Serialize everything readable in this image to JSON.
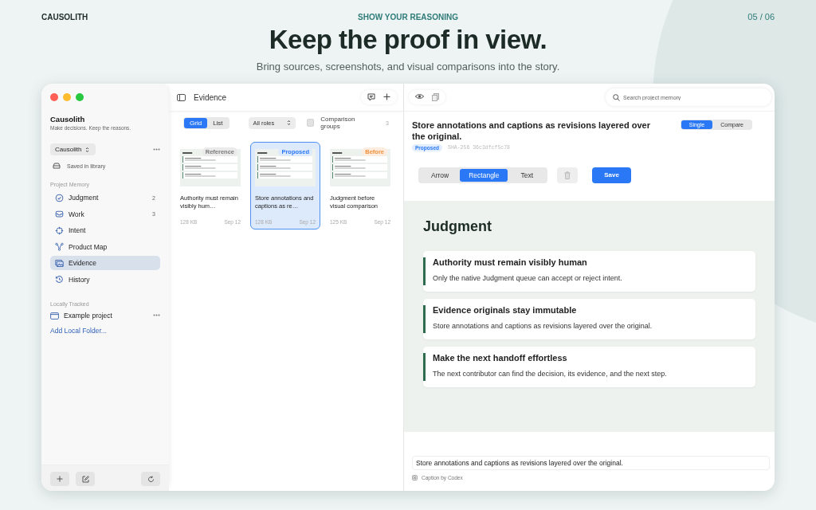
{
  "header": {
    "brand": "CAUSOLITH",
    "kicker": "SHOW YOUR REASONING",
    "page": "05 / 06",
    "title": "Keep the proof in view.",
    "subtitle": "Bring sources, screenshots, and visual comparisons into the story."
  },
  "sidebar": {
    "app_name": "Causolith",
    "tagline": "Make decisions. Keep the reasons.",
    "workspace": "Causolith",
    "save_status": "Saved in library",
    "section_heading": "Project Memory",
    "items": [
      {
        "label": "Judgment",
        "count": "2",
        "kind": "judgment",
        "selected": false
      },
      {
        "label": "Work",
        "count": "3",
        "kind": "work",
        "selected": false
      },
      {
        "label": "Intent",
        "kind": "intent",
        "selected": false
      },
      {
        "label": "Product Map",
        "kind": "map",
        "selected": false
      },
      {
        "label": "Evidence",
        "kind": "evidence",
        "selected": true
      },
      {
        "label": "History",
        "kind": "history",
        "selected": false
      }
    ],
    "tracked_heading": "Locally Tracked",
    "folders": [
      {
        "label": "Example project"
      }
    ],
    "add_folder": "Add Local Folder..."
  },
  "evidence": {
    "title": "Evidence",
    "view_modes": [
      {
        "label": "Grid",
        "selected": true
      },
      {
        "label": "List",
        "selected": false
      }
    ],
    "role_filter": "All roles",
    "comparison_groups": {
      "label": "Comparison groups",
      "checked": false,
      "count": "3"
    },
    "cards": [
      {
        "title": "Authority must remain visibly hum…",
        "size": "128 KB",
        "date": "Sep 12",
        "role": "Reference",
        "color": "#7a7a7a",
        "selected": false
      },
      {
        "title": "Store annotations and captions as re…",
        "size": "128 KB",
        "date": "Sep 12",
        "role": "Proposed",
        "color": "#2a78f5",
        "selected": true
      },
      {
        "title": "Judgment before visual comparison",
        "size": "125 KB",
        "date": "Sep 12",
        "role": "Before",
        "color": "#f0913c",
        "selected": false
      }
    ]
  },
  "detail": {
    "search_placeholder": "Search project memory",
    "title": "Store annotations and captions as revisions layered over the original.",
    "status": "Proposed",
    "hash": "SHA-256 36c3dfcf5c78",
    "view_modes": [
      {
        "label": "Single",
        "selected": true
      },
      {
        "label": "Compare",
        "selected": false
      }
    ],
    "tools": [
      {
        "label": "Arrow",
        "selected": false
      },
      {
        "label": "Rectangle",
        "selected": true
      },
      {
        "label": "Text",
        "selected": false
      }
    ],
    "save": "Save",
    "preview": {
      "heading": "Judgment",
      "items": [
        {
          "title": "Authority must remain visibly human",
          "body": "Only the native Judgment queue can accept or reject intent."
        },
        {
          "title": "Evidence originals stay immutable",
          "body": "Store annotations and captions as revisions layered over the original."
        },
        {
          "title": "Make the next handoff effortless",
          "body": "The next contributor can find the decision, its evidence, and the next step."
        }
      ]
    },
    "caption": "Store annotations and captions as revisions layered over the original.",
    "caption_credit": "Caption by Codex"
  }
}
